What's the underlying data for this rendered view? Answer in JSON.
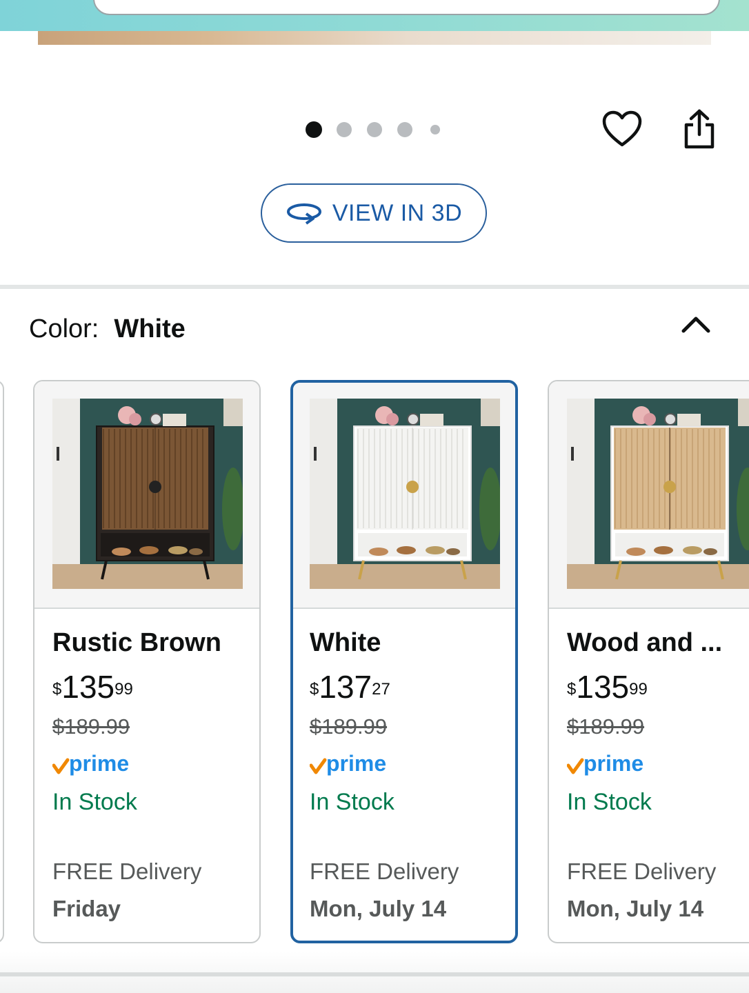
{
  "carousel": {
    "count": 5,
    "active_index": 0
  },
  "actions": {
    "favorite_icon": "heart-icon",
    "share_icon": "share-icon"
  },
  "view3d": {
    "label": "VIEW IN 3D",
    "icon": "rotate-3d-icon"
  },
  "color_selector": {
    "label": "Color:",
    "value": "White",
    "collapse_icon": "chevron-up-icon"
  },
  "variants": [
    {
      "name": "Rustic Brown",
      "price_currency": "$",
      "price_whole": "135",
      "price_cents": "99",
      "list_price": "$189.99",
      "prime": "prime",
      "availability": "In Stock",
      "delivery_label": "FREE Delivery",
      "delivery_date": "Friday",
      "selected": false,
      "door_color": "#7b5635",
      "body_color": "#2b2522"
    },
    {
      "name": "White",
      "price_currency": "$",
      "price_whole": "137",
      "price_cents": "27",
      "list_price": "$189.99",
      "prime": "prime",
      "availability": "In Stock",
      "delivery_label": "FREE Delivery",
      "delivery_date": "Mon, July 14",
      "selected": true,
      "door_color": "#f4f4f2",
      "body_color": "#ffffff"
    },
    {
      "name": "Wood and ...",
      "price_currency": "$",
      "price_whole": "135",
      "price_cents": "99",
      "list_price": "$189.99",
      "prime": "prime",
      "availability": "In Stock",
      "delivery_label": "FREE Delivery",
      "delivery_date": "Mon, July 14",
      "selected": false,
      "door_color": "#d9b98e",
      "body_color": "#ffffff"
    }
  ],
  "colors": {
    "accent_blue": "#2162a1",
    "link_blue": "#1a5aa5",
    "stock_green": "#007a4d",
    "prime_orange": "#f08804",
    "prime_blue": "#1f8ce6"
  }
}
